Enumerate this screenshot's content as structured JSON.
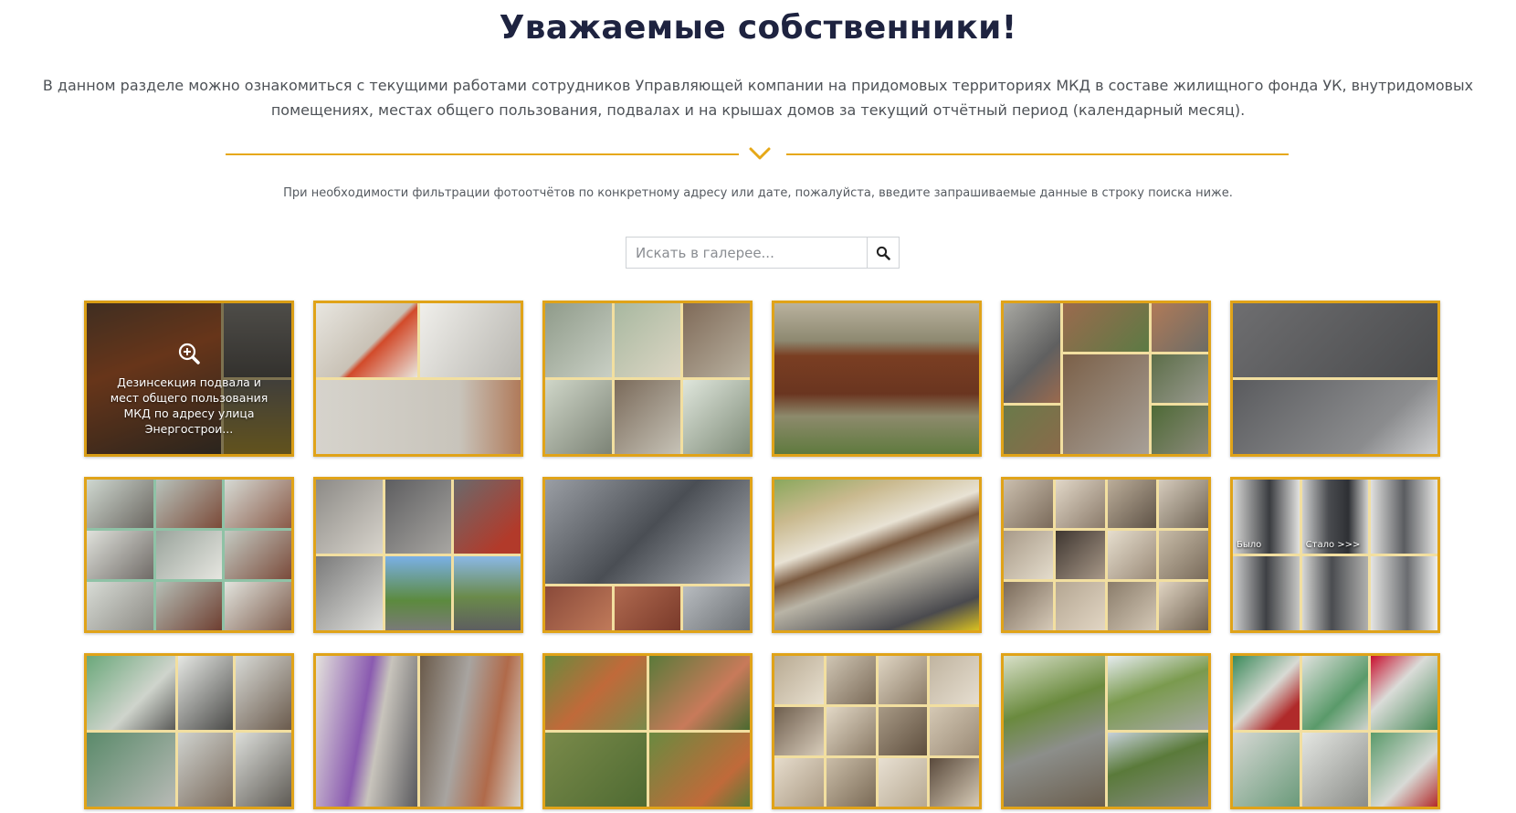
{
  "header": {
    "title": "Уважаемые собственники!",
    "intro": "В данном разделе можно ознакомиться с текущими работами сотрудников Управляющей компании на придомовых территориях МКД в составе жилищного фонда УК, внутридомовых помещениях, местах общего пользования, подвалах и на крышах домов за текущий отчётный период (календарный месяц).",
    "hint": "При необходимости фильтрации фотоотчётов по конкретному адресу или дате, пожалуйста, введите запрашиваемые данные в строку поиска ниже."
  },
  "search": {
    "placeholder": "Искать в галерее...",
    "icon": "search-icon"
  },
  "colors": {
    "accent": "#e6a817",
    "title": "#1e2340",
    "tile_border": "#e0a319"
  },
  "gallery": {
    "items": [
      {
        "caption": "Дезинсекция подвала и мест общего пользования МКД по адресу улица Энергострои...",
        "hovered": true,
        "zoom_icon": "zoom-in-icon"
      },
      {
        "caption": ""
      },
      {
        "caption": ""
      },
      {
        "caption": ""
      },
      {
        "caption": ""
      },
      {
        "caption": ""
      },
      {
        "caption": ""
      },
      {
        "caption": ""
      },
      {
        "caption": ""
      },
      {
        "caption": ""
      },
      {
        "caption": ""
      },
      {
        "caption": "",
        "photo_labels": [
          "Было",
          "Стало >>>"
        ]
      },
      {
        "caption": ""
      },
      {
        "caption": ""
      },
      {
        "caption": ""
      },
      {
        "caption": ""
      },
      {
        "caption": ""
      },
      {
        "caption": ""
      }
    ]
  }
}
